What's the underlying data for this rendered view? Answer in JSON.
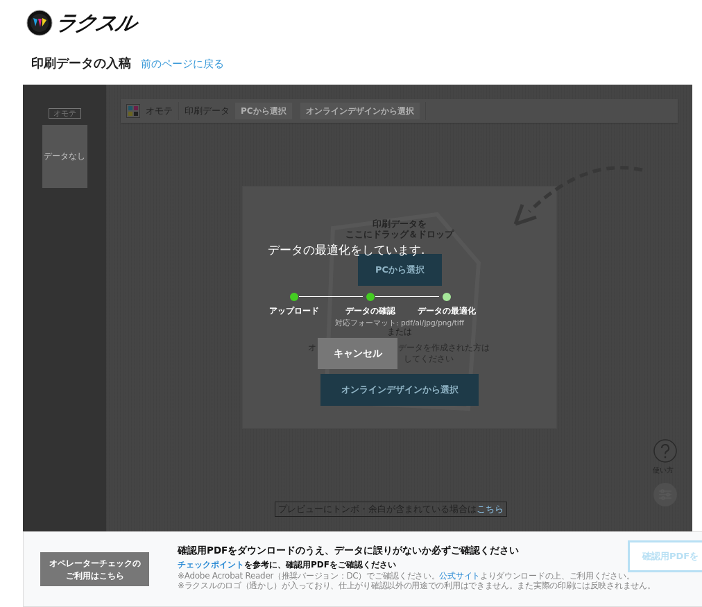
{
  "header": {
    "logo": "ラクスル",
    "title": "印刷データの入稿",
    "back_link": "前のページに戻る"
  },
  "sidebar": {
    "side_label": "オモテ",
    "thumbnail_text": "データなし"
  },
  "toolbar": {
    "side": "オモテ",
    "section": "印刷データ",
    "buttons": [
      {
        "label": "PCから選択",
        "disabled": true
      },
      {
        "label": "オンラインデザインから選択",
        "disabled": true
      }
    ]
  },
  "drop_zone": {
    "heading_lines": [
      "印刷データを",
      "ここにドラッグ＆ドロップ"
    ],
    "pc_button": "PCから選択",
    "formats": "対応フォーマット: pdf/ai/jpg/png/tiff",
    "or_text": "または",
    "online_note_fragments": [
      "オ",
      "データを作成された方は",
      "してください"
    ],
    "online_button": "オンラインデザインから選択"
  },
  "help": {
    "label": "使い方"
  },
  "preview_note": {
    "text": "プレビューにトンボ・余白が含まれている場合は",
    "link": "こちら"
  },
  "overlay": {
    "message": "データの最適化をしています.",
    "steps": [
      {
        "label": "アップロード",
        "done": true
      },
      {
        "label": "データの確認",
        "done": true
      },
      {
        "label": "データの最適化",
        "done": false
      }
    ],
    "cancel_button": "キャンセル"
  },
  "footer": {
    "operator_button_lines": [
      "オペレーターチェックの",
      "ご利用はこちら"
    ],
    "headline": "確認用PDFをダウンロードのうえ、データに誤りがないか必ずご確認ください",
    "instruction_link": "チェックポイント",
    "instruction_text": "を参考に、確認用PDFをご確認ください",
    "note_1_before": "※Adobe Acrobat Reader（推奨バージョン：DC）でご確認ください。",
    "note_1_link": "公式サイト",
    "note_1_after": "よりダウンロードの上、ご利用ください。",
    "note_2": "※ラクスルのロゴ（透かし）が入っており、仕上がり確認以外の用途での利用はできません。また実際の印刷には反映されません。",
    "download_button": "確認用PDFを"
  }
}
